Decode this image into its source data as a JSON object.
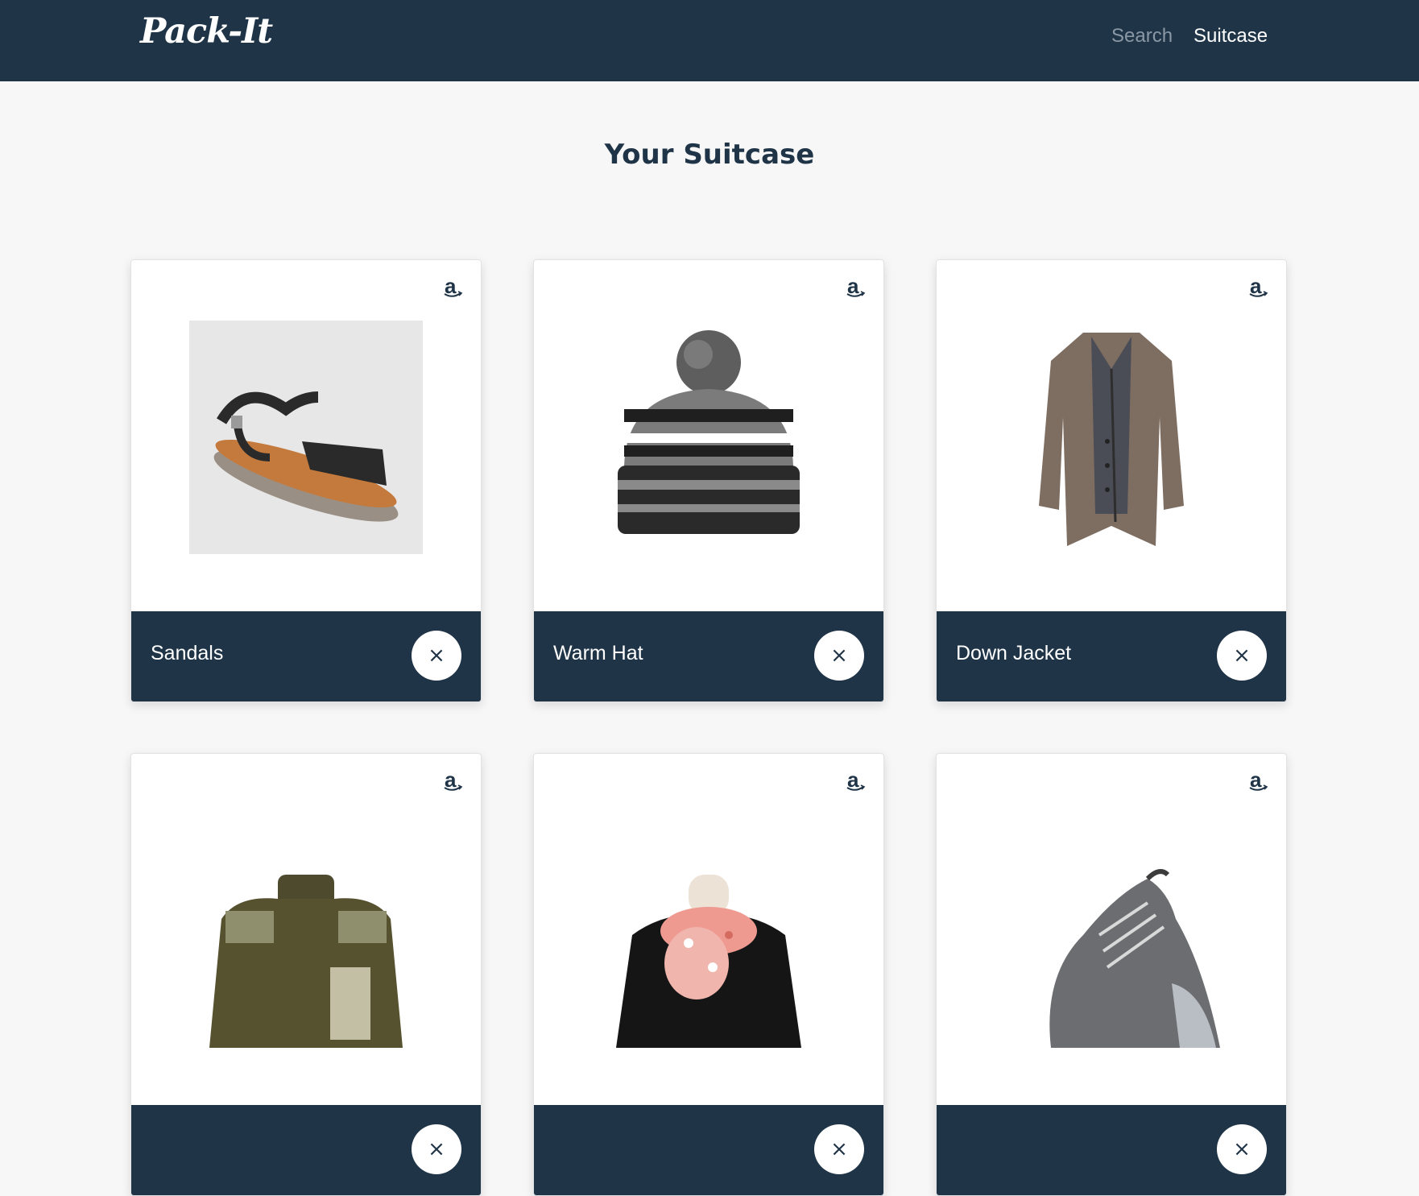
{
  "header": {
    "brand": "Pack-It",
    "nav": {
      "search_label": "Search",
      "suitcase_label": "Suitcase"
    }
  },
  "page": {
    "title": "Your Suitcase"
  },
  "colors": {
    "navy": "#1f3447",
    "background": "#f7f7f7",
    "card": "#ffffff"
  },
  "icons": {
    "store": "amazon-icon",
    "remove": "close-icon"
  },
  "items": [
    {
      "name": "Sandals",
      "remove_label": "×"
    },
    {
      "name": "Warm Hat",
      "remove_label": "×"
    },
    {
      "name": "Down Jacket",
      "remove_label": "×"
    },
    {
      "name": "",
      "remove_label": "×"
    },
    {
      "name": "",
      "remove_label": "×"
    },
    {
      "name": "",
      "remove_label": "×"
    }
  ]
}
